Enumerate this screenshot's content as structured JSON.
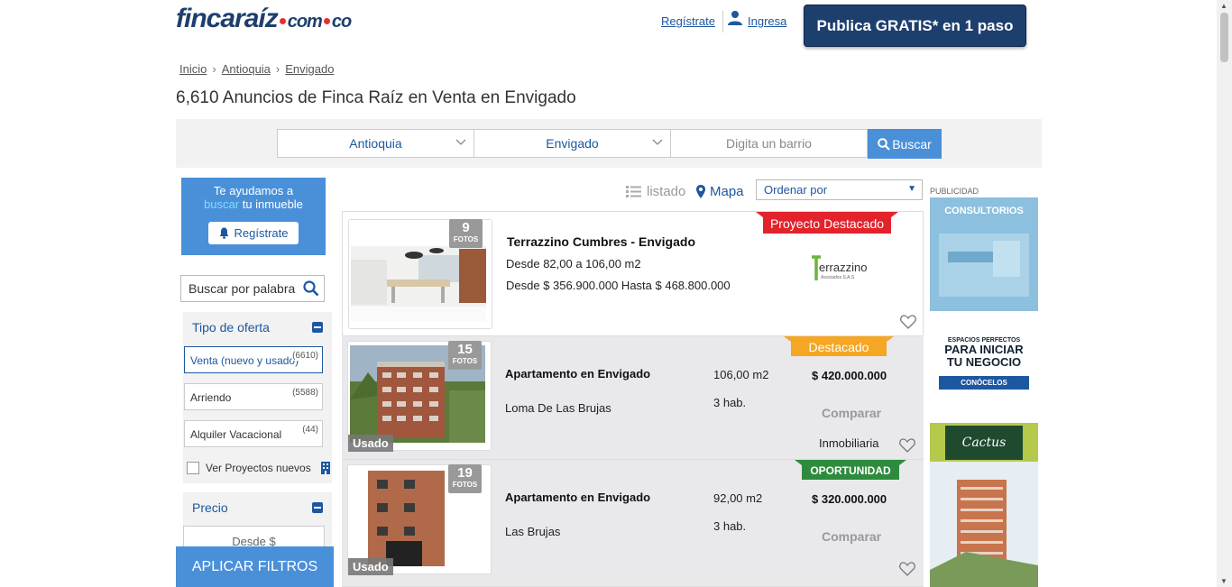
{
  "header": {
    "logo_main": "fincaraíz",
    "logo_com": "com",
    "logo_co": "co",
    "register_link": "Regístrate",
    "login_link": "Ingresa",
    "publish_button": "Publica GRATIS* en 1 paso"
  },
  "breadcrumb": [
    "Inicio",
    "Antioquia",
    "Envigado"
  ],
  "page_title": "6,610 Anuncios de Finca Raíz en Venta en Envigado",
  "search": {
    "department": "Antioquia",
    "city": "Envigado",
    "barrio_placeholder": "Digita un barrio",
    "search_button": "Buscar"
  },
  "sidebar": {
    "help_line1": "Te ayudamos a",
    "help_highlight": "buscar",
    "help_rest": " tu inmueble",
    "help_button": "Regístrate",
    "keyword_placeholder": "Buscar por palabra",
    "offer_title": "Tipo de oferta",
    "offers": [
      {
        "label": "Venta (nuevo y usado)",
        "count": "(6610)"
      },
      {
        "label": "Arriendo",
        "count": "(5588)"
      },
      {
        "label": "Alquiler Vacacional",
        "count": "(44)"
      }
    ],
    "projects_checkbox": "Ver Proyectos nuevos",
    "price_title": "Precio",
    "price_from": "Desde $",
    "apply_button": "APLICAR FILTROS"
  },
  "toolbar": {
    "list_view": "listado",
    "map_view": "Mapa",
    "order_by": "Ordenar por"
  },
  "listings": [
    {
      "photos": "9",
      "photos_label": "FOTOS",
      "badge": "Proyecto Destacado",
      "title": "Terrazzino Cumbres - Envigado",
      "area": "Desde 82,00 a 106,00 m2",
      "price_range": "Desde $ 356.900.000 Hasta $ 468.800.000",
      "company": "errazzino",
      "company_sub": "Asociados S.A.S"
    },
    {
      "photos": "15",
      "photos_label": "FOTOS",
      "badge": "Destacado",
      "condition": "Usado",
      "title": "Apartamento en Envigado",
      "area": "106,00 m2",
      "price": "$ 420.000.000",
      "location": "Loma De Las Brujas",
      "rooms": "3 hab.",
      "compare": "Comparar",
      "agent": "Inmobiliaria"
    },
    {
      "photos": "19",
      "photos_label": "FOTOS",
      "badge": "OPORTUNIDAD",
      "condition": "Usado",
      "title": "Apartamento en Envigado",
      "area": "92,00 m2",
      "price": "$ 320.000.000",
      "location": "Las Brujas",
      "rooms": "3 hab.",
      "compare": "Comparar"
    }
  ],
  "ads": {
    "label": "PUBLICIDAD",
    "ad1_title": "CONSULTORIOS",
    "ad2_small": "ESPACIOS PERFECTOS",
    "ad2_line1": "PARA INICIAR",
    "ad2_line2": "TU NEGOCIO",
    "ad2_button": "CONÓCELOS",
    "ad3_logo": "Cactus"
  },
  "colors": {
    "brand_dark": "#1d3f6e",
    "link_blue": "#1d57a0",
    "button_blue": "#4a90d9",
    "badge_red": "#e3232b",
    "badge_orange": "#f5a623",
    "badge_green": "#2e8b3d"
  }
}
